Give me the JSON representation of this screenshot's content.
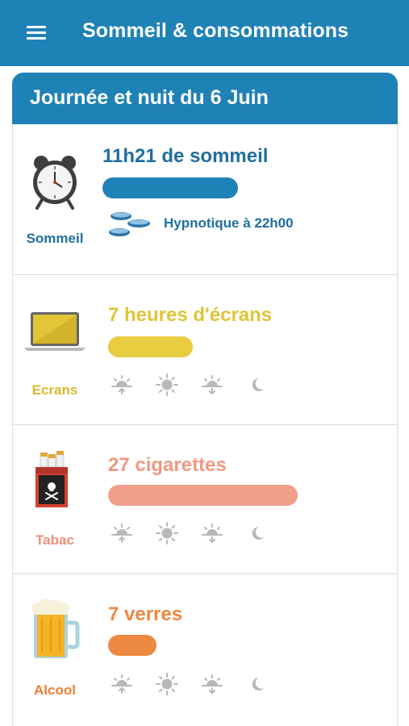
{
  "appbar": {
    "title": "Sommeil & consommations",
    "menu_icon": "hamburger-menu-icon"
  },
  "day": {
    "title": "Journée et nuit du 6 Juin"
  },
  "colors": {
    "primary": "#1f82b7",
    "sleep": "#1f6f9e",
    "screens": "#e8cd40",
    "tobacco": "#f0a08a",
    "alcohol": "#ec8840",
    "muted": "#b8b8b8"
  },
  "cards": {
    "sleep": {
      "label": "Sommeil",
      "value": "11h21 de sommeil",
      "icon": "alarm-clock-icon",
      "bar_level": 0.48,
      "medication": {
        "icon": "pills-icon",
        "text": "Hypnotique à 22h00"
      }
    },
    "screens": {
      "label": "Ecrans",
      "value": "7 heures d'écrans",
      "icon": "laptop-icon",
      "bar_level": 0.3,
      "times": [
        "morning",
        "midday",
        "evening",
        "night"
      ]
    },
    "tobacco": {
      "label": "Tabac",
      "value": "27 cigarettes",
      "icon": "cigarette-pack-icon",
      "bar_level": 0.67,
      "times": [
        "morning",
        "midday",
        "evening",
        "night"
      ]
    },
    "alcohol": {
      "label": "Alcool",
      "value": "7 verres",
      "icon": "beer-mug-icon",
      "bar_level": 0.17,
      "times": [
        "morning",
        "midday",
        "evening",
        "night"
      ]
    }
  }
}
